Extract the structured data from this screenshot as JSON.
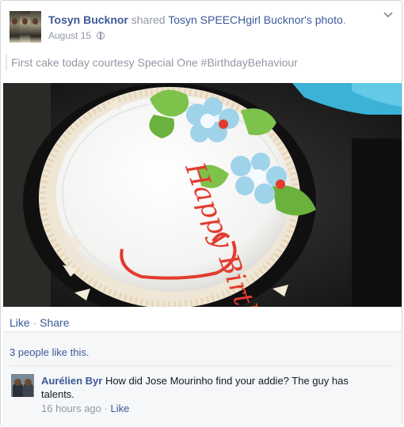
{
  "post": {
    "author": "Tosyn Bucknor",
    "action": "shared",
    "shared_target": "Tosyn SPEECHgirl Bucknor's photo",
    "period": ".",
    "date": "August 15",
    "privacy_icon": "globe-icon",
    "menu_icon": "chevron-down-icon",
    "caption": "First cake today courtesy Special One #BirthdayBehaviour",
    "photo_text": "Happy Birthday"
  },
  "actions": {
    "like_label": "Like",
    "separator": "·",
    "share_label": "Share"
  },
  "feedback": {
    "likes_summary": "3 people like this."
  },
  "comments": [
    {
      "author": "Aurélien Byr",
      "text": "How did Jose Mourinho find your addie? The guy has talents.",
      "time": "16 hours ago",
      "separator": "·",
      "like_label": "Like"
    }
  ],
  "colors": {
    "link": "#3b5998",
    "muted": "#9197a3",
    "icing": "#e23b2e"
  }
}
